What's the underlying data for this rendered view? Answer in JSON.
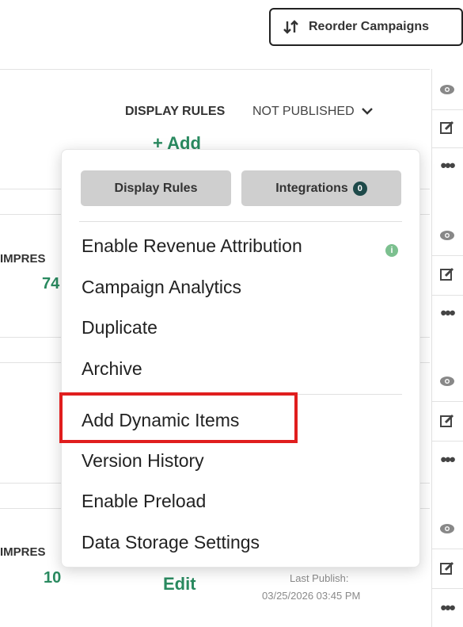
{
  "toolbar": {
    "reorder_label": "Reorder Campaigns"
  },
  "row1": {
    "display_rules_label": "DISPLAY RULES",
    "status_label": "NOT PUBLISHED",
    "add_label": "+ Add"
  },
  "row2": {
    "impressions_label": "IMPRES",
    "impressions_value": "74"
  },
  "row4": {
    "impressions_label": "IMPRES",
    "impressions_value": "10",
    "edit_label": "Edit",
    "last_publish_label": "Last Publish:",
    "last_publish_date": "03/25/2026 03:45 PM"
  },
  "menu": {
    "tabs": [
      {
        "label": "Display Rules"
      },
      {
        "label": "Integrations",
        "badge": "0"
      }
    ],
    "items": [
      {
        "label": "Enable Revenue Attribution"
      },
      {
        "label": "Campaign Analytics"
      },
      {
        "label": "Duplicate"
      },
      {
        "label": "Archive"
      },
      {
        "label": "Add Dynamic Items"
      },
      {
        "label": "Version History"
      },
      {
        "label": "Enable Preload"
      },
      {
        "label": "Data Storage Settings"
      }
    ],
    "info_icon_glyph": "i",
    "highlighted_item": "Add Dynamic Items"
  },
  "colors": {
    "accent_green": "#2a8a60",
    "badge_dark": "#1e4a4a",
    "highlight_red": "#e01e1e",
    "tab_gray": "#cfcfcf"
  },
  "icons": {
    "reorder": "sort-arrows-icon",
    "view": "eye-icon",
    "edit": "edit-icon",
    "more": "more-dots-icon",
    "status": "chevron-down-icon",
    "info": "info-icon"
  }
}
